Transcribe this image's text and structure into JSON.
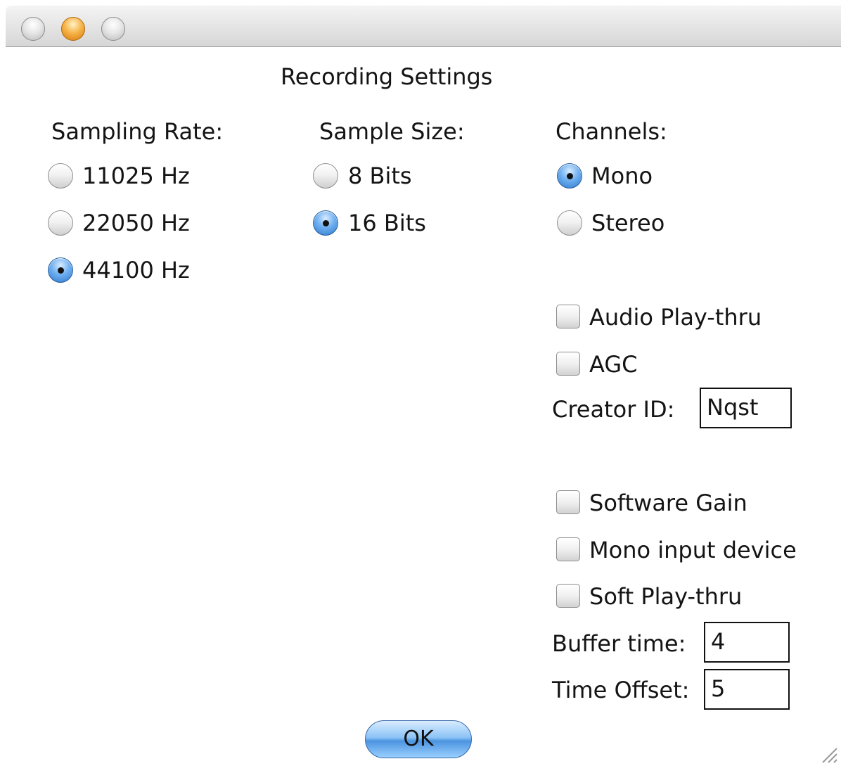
{
  "window": {
    "controls": [
      "close",
      "minimize",
      "zoom"
    ],
    "title": "Recording Settings"
  },
  "sampling_rate": {
    "label": "Sampling Rate:",
    "options": [
      {
        "label": "11025 Hz",
        "selected": false
      },
      {
        "label": "22050 Hz",
        "selected": false
      },
      {
        "label": "44100 Hz",
        "selected": true
      }
    ]
  },
  "sample_size": {
    "label": "Sample Size:",
    "options": [
      {
        "label": "8 Bits",
        "selected": false
      },
      {
        "label": "16 Bits",
        "selected": true
      }
    ]
  },
  "channels": {
    "label": "Channels:",
    "options": [
      {
        "label": "Mono",
        "selected": true
      },
      {
        "label": "Stereo",
        "selected": false
      }
    ]
  },
  "checkboxes": {
    "audio_play_thru": {
      "label": "Audio Play-thru",
      "checked": false
    },
    "agc": {
      "label": "AGC",
      "checked": false
    },
    "software_gain": {
      "label": "Software Gain",
      "checked": false
    },
    "mono_input_device": {
      "label": "Mono input device",
      "checked": false
    },
    "soft_play_thru": {
      "label": "Soft Play-thru",
      "checked": false
    }
  },
  "fields": {
    "creator_id": {
      "label": "Creator ID:",
      "value": "Nqst"
    },
    "buffer_time": {
      "label": "Buffer time:",
      "value": "4"
    },
    "time_offset": {
      "label": "Time Offset:",
      "value": "5"
    }
  },
  "buttons": {
    "ok": "OK"
  },
  "colors": {
    "selected_accent": "#2f78cf",
    "window_background": "#ffffff",
    "minimize_button": "#f6b54a"
  }
}
